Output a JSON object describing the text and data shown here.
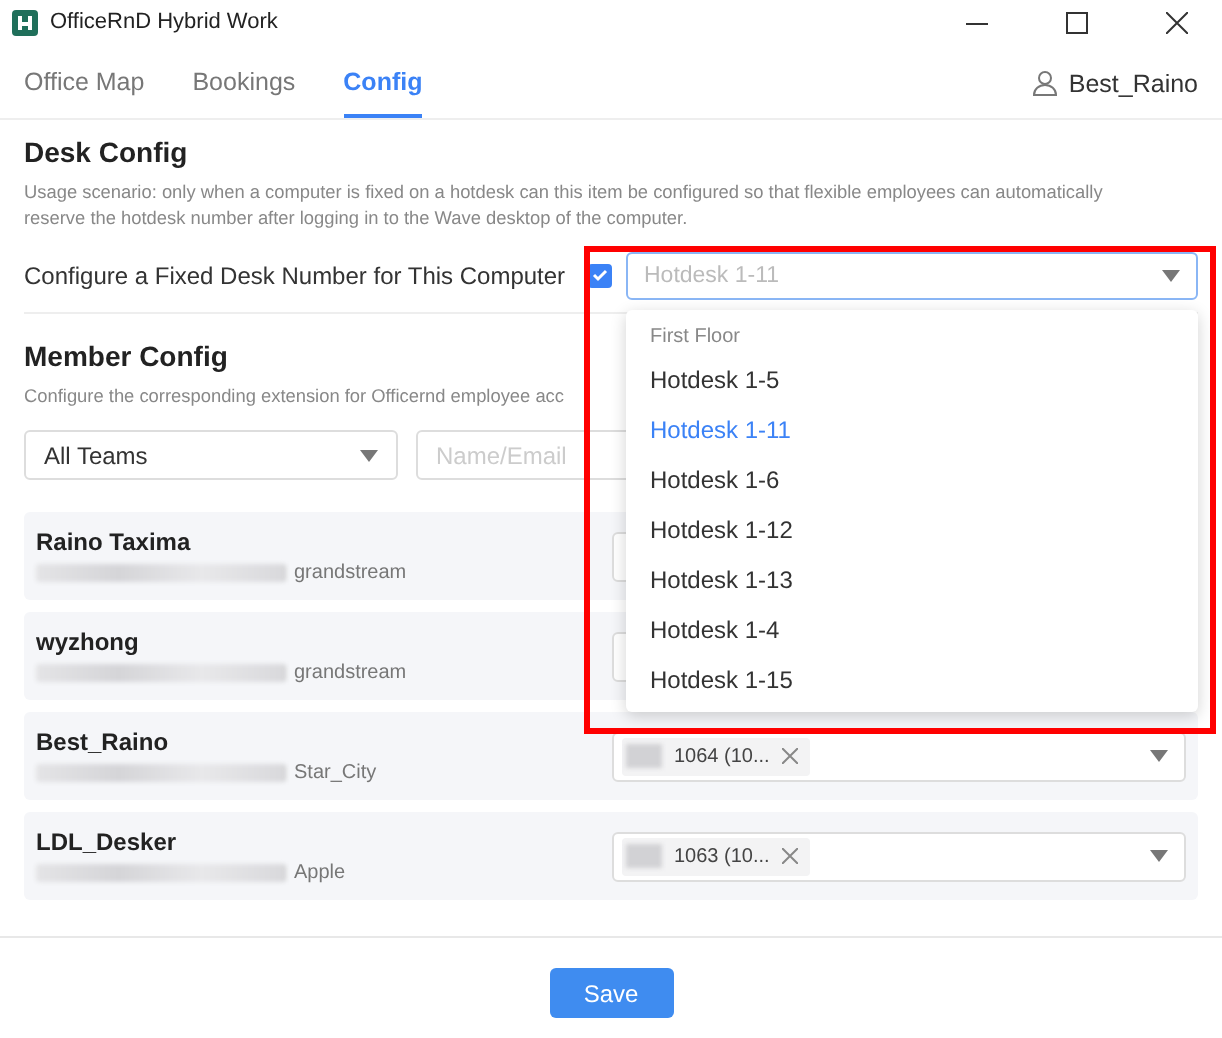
{
  "window": {
    "title": "OfficeRnD Hybrid Work"
  },
  "tabs": [
    {
      "label": "Office Map",
      "selected": false
    },
    {
      "label": "Bookings",
      "selected": false
    },
    {
      "label": "Config",
      "selected": true
    }
  ],
  "user": {
    "name": "Best_Raino"
  },
  "desk_config": {
    "heading": "Desk Config",
    "description": "Usage scenario: only when a computer is fixed on a hotdesk can this item be configured so that flexible employees can automatically reserve the hotdesk number after logging in to the Wave desktop of the computer.",
    "label": "Configure a Fixed Desk Number for This Computer",
    "checked": true,
    "select": {
      "value": "Hotdesk 1-11"
    }
  },
  "dropdown": {
    "group": "First Floor",
    "options": [
      {
        "label": "Hotdesk 1-5",
        "selected": false
      },
      {
        "label": "Hotdesk 1-11",
        "selected": true
      },
      {
        "label": "Hotdesk 1-6",
        "selected": false
      },
      {
        "label": "Hotdesk 1-12",
        "selected": false
      },
      {
        "label": "Hotdesk 1-13",
        "selected": false
      },
      {
        "label": "Hotdesk 1-4",
        "selected": false
      },
      {
        "label": "Hotdesk 1-15",
        "selected": false
      }
    ]
  },
  "member_config": {
    "heading": "Member Config",
    "description": "Configure the corresponding extension for Officernd employee acc",
    "team_filter": {
      "value": "All Teams"
    },
    "search": {
      "placeholder": "Name/Email"
    },
    "members": [
      {
        "name": "Raino Taxima",
        "company": "grandstream"
      },
      {
        "name": "wyzhong",
        "company": "grandstream"
      },
      {
        "name": "Best_Raino",
        "company": "Star_City",
        "tag": "1064 (10..."
      },
      {
        "name": "LDL_Desker",
        "company": "Apple",
        "tag": "1063 (10..."
      }
    ]
  },
  "save_button": "Save"
}
